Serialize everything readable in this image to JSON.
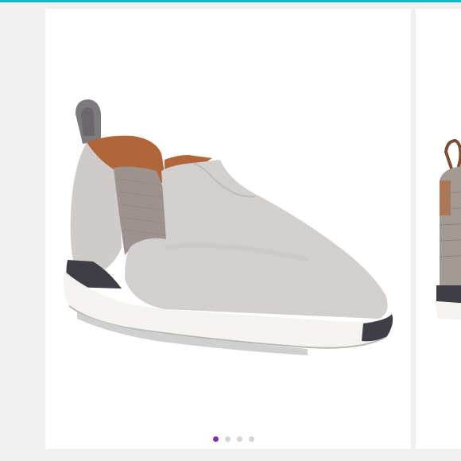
{
  "product_gallery": {
    "images": [
      {
        "alt": "shoe-photo-side-view",
        "color": "#d3cfcd"
      },
      {
        "alt": "shoe-photo-back-view",
        "color": "#9c9188"
      }
    ],
    "pagination": {
      "total": 4,
      "active": 1
    },
    "colors": {
      "accent": "#7e2fa4",
      "top_bar": "#12b8c8",
      "dot_inactive": "#d6d6d8",
      "suede": "#d3cfcd",
      "elastic": "#9c9390",
      "lining": "#b0663a",
      "sole": "#f4f3ef"
    }
  }
}
